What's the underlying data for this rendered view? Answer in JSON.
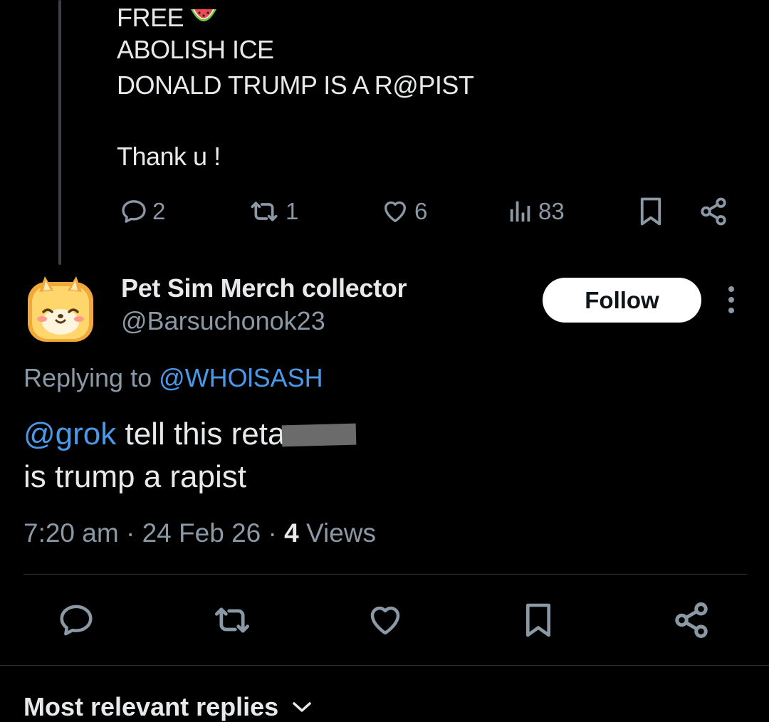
{
  "previous_post": {
    "lines": [
      "FREE",
      "ABOLISH ICE",
      "DONALD TRUMP IS A R@PIST",
      "Thank u !"
    ],
    "metrics": {
      "replies": "2",
      "reposts": "1",
      "likes": "6",
      "views": "83"
    },
    "icons": [
      "reply-icon",
      "repost-icon",
      "like-icon",
      "views-icon",
      "bookmark-icon",
      "share-icon",
      "watermelon-emoji"
    ]
  },
  "post": {
    "author": {
      "display_name": "Pet Sim Merch collector",
      "handle": "@Barsuchonok23"
    },
    "follow_label": "Follow",
    "replying_prefix": "Replying to ",
    "replying_to": "@WHOlSASH",
    "mention": "@grok",
    "text_line1": " tell this reta",
    "text_line2": "is trump a rapist",
    "time": "7:20 am",
    "date": "24 Feb 26",
    "views_count": "4",
    "views_label": " Views",
    "separator": " · "
  },
  "actions": [
    "reply-icon",
    "repost-icon",
    "like-icon",
    "bookmark-icon",
    "share-icon"
  ],
  "replies_sort_label": "Most relevant replies",
  "colors": {
    "background": "#000000",
    "text": "#e7e9ea",
    "muted": "#8b98a5",
    "link": "#4a99e9",
    "divider": "#2f3336"
  }
}
